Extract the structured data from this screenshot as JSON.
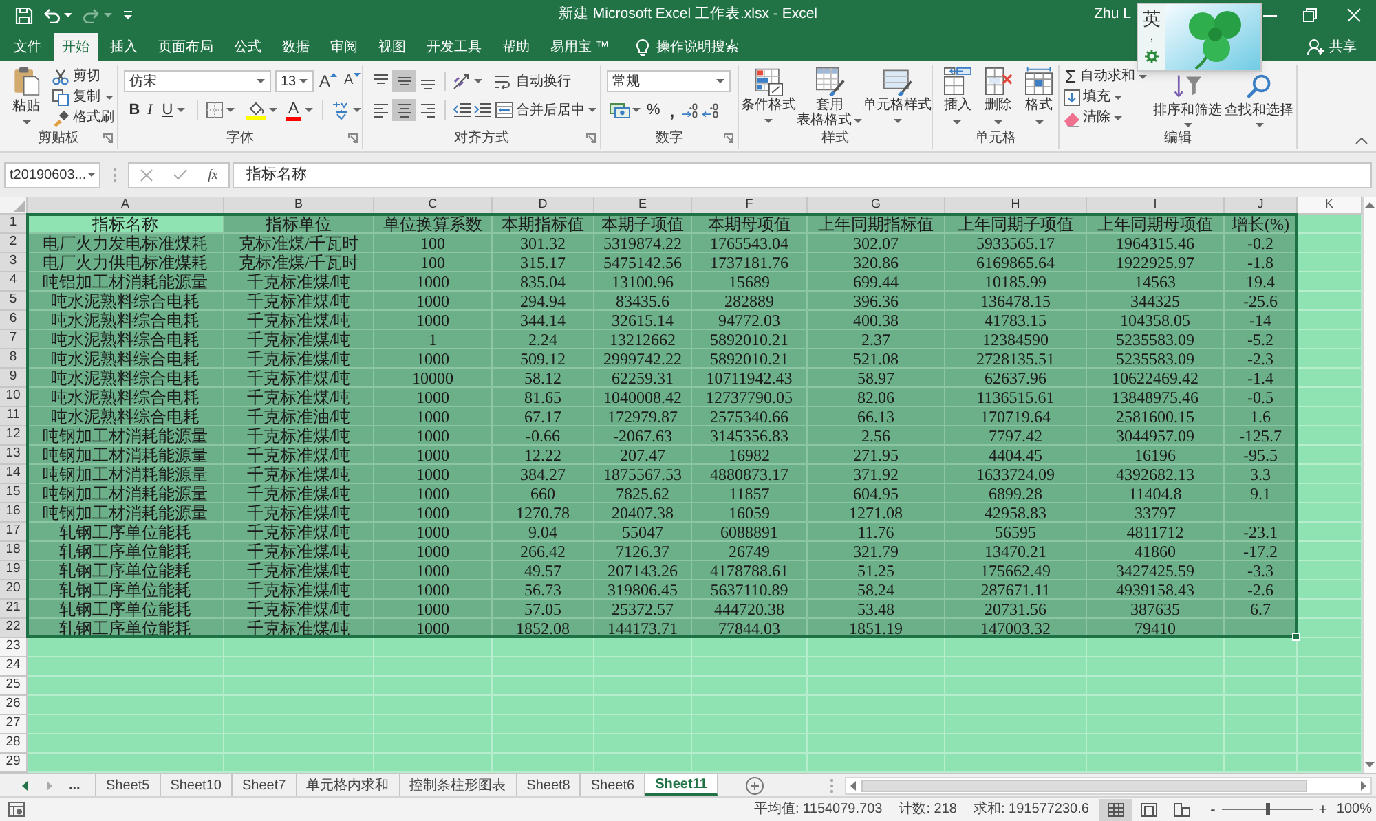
{
  "title_bar": {
    "quick_access": [
      {
        "kind": "save",
        "disabled": false
      },
      {
        "kind": "undo",
        "disabled": false
      },
      {
        "kind": "redo",
        "disabled": true
      },
      {
        "kind": "customize",
        "disabled": false
      }
    ],
    "title": "新建 Microsoft Excel 工作表.xlsx - Excel",
    "user": "Zhu L",
    "window_controls": [
      {
        "kind": "minimize"
      },
      {
        "kind": "restore"
      },
      {
        "kind": "close"
      }
    ]
  },
  "ime": {
    "mode": "英",
    "punctuation": ","
  },
  "menu": {
    "tabs": [
      {
        "label": "文件",
        "selected": false
      },
      {
        "label": "开始",
        "selected": true
      },
      {
        "label": "插入",
        "selected": false
      },
      {
        "label": "页面布局",
        "selected": false
      },
      {
        "label": "公式",
        "selected": false
      },
      {
        "label": "数据",
        "selected": false
      },
      {
        "label": "审阅",
        "selected": false
      },
      {
        "label": "视图",
        "selected": false
      },
      {
        "label": "开发工具",
        "selected": false
      },
      {
        "label": "帮助",
        "selected": false
      },
      {
        "label": "易用宝 ™",
        "selected": false
      }
    ],
    "tell_me": "操作说明搜索",
    "share": "共享"
  },
  "ribbon": {
    "clipboard": {
      "label": "剪贴板",
      "paste": "粘贴",
      "cut": "剪切",
      "copy": "复制",
      "format_painter": "格式刷"
    },
    "font": {
      "label": "字体",
      "font_name": "仿宋",
      "font_size": "13",
      "grow": "A",
      "shrink": "A",
      "bold": "B",
      "italic": "I",
      "underline": "U",
      "font_color": "A"
    },
    "alignment": {
      "label": "对齐方式",
      "vertical": [
        {
          "kind": "top",
          "selected": false
        },
        {
          "kind": "middle",
          "selected": true
        },
        {
          "kind": "bottom",
          "selected": false
        }
      ],
      "horizontal": [
        {
          "kind": "left",
          "selected": false
        },
        {
          "kind": "center",
          "selected": true
        },
        {
          "kind": "right",
          "selected": false
        }
      ],
      "wrap_text": "自动换行",
      "merge_center": "合并后居中"
    },
    "number": {
      "label": "数字",
      "format": "常规",
      "percent": "%",
      "comma": ","
    },
    "styles": {
      "label": "样式",
      "buttons": [
        {
          "kind": "conditional",
          "lines": [
            "条件格式"
          ]
        },
        {
          "kind": "table",
          "lines": [
            "套用",
            "表格格式"
          ]
        },
        {
          "kind": "cell_styles",
          "lines": [
            "单元格样式"
          ]
        }
      ]
    },
    "cells": {
      "label": "单元格",
      "buttons": [
        {
          "kind": "insert",
          "label": "插入"
        },
        {
          "kind": "delete",
          "label": "删除"
        },
        {
          "kind": "format",
          "label": "格式"
        }
      ]
    },
    "editing": {
      "label": "编辑",
      "small": [
        {
          "kind": "autosum",
          "symbol": "Σ",
          "label": "自动求和"
        },
        {
          "kind": "fill",
          "label": "填充"
        },
        {
          "kind": "clear",
          "label": "清除"
        }
      ],
      "large": [
        {
          "kind": "sort",
          "label": "排序和筛选"
        },
        {
          "kind": "find",
          "label": "查找和选择"
        }
      ]
    }
  },
  "formula_bar": {
    "name_box": "t20190603...",
    "function_symbol": "fx",
    "formula": "指标名称"
  },
  "sheet": {
    "columns": [
      {
        "label": "A",
        "selected": true
      },
      {
        "label": "B",
        "selected": true
      },
      {
        "label": "C",
        "selected": true
      },
      {
        "label": "D",
        "selected": true
      },
      {
        "label": "E",
        "selected": true
      },
      {
        "label": "F",
        "selected": true
      },
      {
        "label": "G",
        "selected": true
      },
      {
        "label": "H",
        "selected": true
      },
      {
        "label": "I",
        "selected": true
      },
      {
        "label": "J",
        "selected": true
      },
      {
        "label": "K",
        "selected": false
      }
    ],
    "rows": [
      {
        "number": "1",
        "selected": true,
        "cells": [
          "指标名称",
          "指标单位",
          "单位换算系数",
          "本期指标值",
          "本期子项值",
          "本期母项值",
          "上年同期指标值",
          "上年同期子项值",
          "上年同期母项值",
          "增长(%)"
        ]
      },
      {
        "number": "2",
        "selected": true,
        "cells": [
          "电厂火力发电标准煤耗",
          "克标准煤/千瓦时",
          "100",
          "301.32",
          "5319874.22",
          "1765543.04",
          "302.07",
          "5933565.17",
          "1964315.46",
          "-0.2"
        ]
      },
      {
        "number": "3",
        "selected": true,
        "cells": [
          "电厂火力供电标准煤耗",
          "克标准煤/千瓦时",
          "100",
          "315.17",
          "5475142.56",
          "1737181.76",
          "320.86",
          "6169865.64",
          "1922925.97",
          "-1.8"
        ]
      },
      {
        "number": "4",
        "selected": true,
        "cells": [
          "吨铝加工材消耗能源量",
          "千克标准煤/吨",
          "1000",
          "835.04",
          "13100.96",
          "15689",
          "699.44",
          "10185.99",
          "14563",
          "19.4"
        ]
      },
      {
        "number": "5",
        "selected": true,
        "cells": [
          "吨水泥熟料综合电耗",
          "千克标准煤/吨",
          "1000",
          "294.94",
          "83435.6",
          "282889",
          "396.36",
          "136478.15",
          "344325",
          "-25.6"
        ]
      },
      {
        "number": "6",
        "selected": true,
        "cells": [
          "吨水泥熟料综合电耗",
          "千克标准煤/吨",
          "1000",
          "344.14",
          "32615.14",
          "94772.03",
          "400.38",
          "41783.15",
          "104358.05",
          "-14"
        ]
      },
      {
        "number": "7",
        "selected": true,
        "cells": [
          "吨水泥熟料综合电耗",
          "千克标准煤/吨",
          "1",
          "2.24",
          "13212662",
          "5892010.21",
          "2.37",
          "12384590",
          "5235583.09",
          "-5.2"
        ]
      },
      {
        "number": "8",
        "selected": true,
        "cells": [
          "吨水泥熟料综合电耗",
          "千克标准煤/吨",
          "1000",
          "509.12",
          "2999742.22",
          "5892010.21",
          "521.08",
          "2728135.51",
          "5235583.09",
          "-2.3"
        ]
      },
      {
        "number": "9",
        "selected": true,
        "cells": [
          "吨水泥熟料综合电耗",
          "千克标准煤/吨",
          "10000",
          "58.12",
          "62259.31",
          "10711942.43",
          "58.97",
          "62637.96",
          "10622469.42",
          "-1.4"
        ]
      },
      {
        "number": "10",
        "selected": true,
        "cells": [
          "吨水泥熟料综合电耗",
          "千克标准煤/吨",
          "1000",
          "81.65",
          "1040008.42",
          "12737790.05",
          "82.06",
          "1136515.61",
          "13848975.46",
          "-0.5"
        ]
      },
      {
        "number": "11",
        "selected": true,
        "cells": [
          "吨水泥熟料综合电耗",
          "千克标准油/吨",
          "1000",
          "67.17",
          "172979.87",
          "2575340.66",
          "66.13",
          "170719.64",
          "2581600.15",
          "1.6"
        ]
      },
      {
        "number": "12",
        "selected": true,
        "cells": [
          "吨钢加工材消耗能源量",
          "千克标准煤/吨",
          "1000",
          "-0.66",
          "-2067.63",
          "3145356.83",
          "2.56",
          "7797.42",
          "3044957.09",
          "-125.7"
        ]
      },
      {
        "number": "13",
        "selected": true,
        "cells": [
          "吨钢加工材消耗能源量",
          "千克标准煤/吨",
          "1000",
          "12.22",
          "207.47",
          "16982",
          "271.95",
          "4404.45",
          "16196",
          "-95.5"
        ]
      },
      {
        "number": "14",
        "selected": true,
        "cells": [
          "吨钢加工材消耗能源量",
          "千克标准煤/吨",
          "1000",
          "384.27",
          "1875567.53",
          "4880873.17",
          "371.92",
          "1633724.09",
          "4392682.13",
          "3.3"
        ]
      },
      {
        "number": "15",
        "selected": true,
        "cells": [
          "吨钢加工材消耗能源量",
          "千克标准煤/吨",
          "1000",
          "660",
          "7825.62",
          "11857",
          "604.95",
          "6899.28",
          "11404.8",
          "9.1"
        ]
      },
      {
        "number": "16",
        "selected": true,
        "cells": [
          "吨钢加工材消耗能源量",
          "千克标准煤/吨",
          "1000",
          "1270.78",
          "20407.38",
          "16059",
          "1271.08",
          "42958.83",
          "33797"
        ]
      },
      {
        "number": "17",
        "selected": true,
        "cells": [
          "轧钢工序单位能耗",
          "千克标准煤/吨",
          "1000",
          "9.04",
          "55047",
          "6088891",
          "11.76",
          "56595",
          "4811712",
          "-23.1"
        ]
      },
      {
        "number": "18",
        "selected": true,
        "cells": [
          "轧钢工序单位能耗",
          "千克标准煤/吨",
          "1000",
          "266.42",
          "7126.37",
          "26749",
          "321.79",
          "13470.21",
          "41860",
          "-17.2"
        ]
      },
      {
        "number": "19",
        "selected": true,
        "cells": [
          "轧钢工序单位能耗",
          "千克标准煤/吨",
          "1000",
          "49.57",
          "207143.26",
          "4178788.61",
          "51.25",
          "175662.49",
          "3427425.59",
          "-3.3"
        ]
      },
      {
        "number": "20",
        "selected": true,
        "cells": [
          "轧钢工序单位能耗",
          "千克标准煤/吨",
          "1000",
          "56.73",
          "319806.45",
          "5637110.89",
          "58.24",
          "287671.11",
          "4939158.43",
          "-2.6"
        ]
      },
      {
        "number": "21",
        "selected": true,
        "cells": [
          "轧钢工序单位能耗",
          "千克标准煤/吨",
          "1000",
          "57.05",
          "25372.57",
          "444720.38",
          "53.48",
          "20731.56",
          "387635",
          "6.7"
        ]
      },
      {
        "number": "22",
        "selected": true,
        "cells": [
          "轧钢工序单位能耗",
          "千克标准煤/吨",
          "1000",
          "1852.08",
          "144173.71",
          "77844.03",
          "1851.19",
          "147003.32",
          "79410"
        ]
      },
      {
        "number": "23",
        "selected": false
      },
      {
        "number": "24",
        "selected": false
      },
      {
        "number": "25",
        "selected": false
      },
      {
        "number": "26",
        "selected": false
      },
      {
        "number": "27",
        "selected": false
      },
      {
        "number": "28",
        "selected": false
      },
      {
        "number": "29",
        "selected": false
      }
    ]
  },
  "sheet_tabs": {
    "more": "...",
    "tabs": [
      {
        "label": "Sheet5",
        "selected": false
      },
      {
        "label": "Sheet10",
        "selected": false
      },
      {
        "label": "Sheet7",
        "selected": false
      },
      {
        "label": "单元格内求和",
        "selected": false
      },
      {
        "label": "控制条柱形图表",
        "selected": false
      },
      {
        "label": "Sheet8",
        "selected": false
      },
      {
        "label": "Sheet6",
        "selected": false
      },
      {
        "label": "Sheet11",
        "selected": true
      }
    ]
  },
  "status_bar": {
    "average": "平均值: 1154079.703",
    "count": "计数: 218",
    "sum": "求和: 191577230.6",
    "views": [
      {
        "kind": "normal",
        "selected": true
      },
      {
        "kind": "page_layout",
        "selected": false
      },
      {
        "kind": "page_break",
        "selected": false
      }
    ],
    "zoom": {
      "minus": "-",
      "plus": "+",
      "level": 0.5,
      "reading": "100%"
    }
  }
}
